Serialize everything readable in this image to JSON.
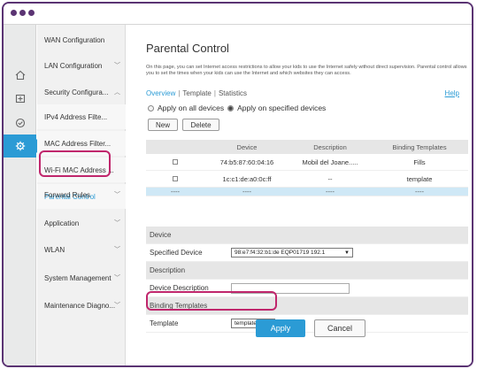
{
  "window": {
    "colors": {
      "frame": "#5b3473",
      "accent": "#2b9bd5",
      "highlight": "#c0266c"
    }
  },
  "sidebar": {
    "items": [
      {
        "label": "WAN Configuration",
        "has_chevron": false
      },
      {
        "label": "LAN Configuration",
        "has_chevron": true
      },
      {
        "label": "Security Configura...",
        "has_chevron": true
      },
      {
        "label": "IPv4 Address Filte..."
      },
      {
        "label": "MAC Address Filter..."
      },
      {
        "label": "Wi-Fi MAC Address ..."
      },
      {
        "label": "Parental Control"
      },
      {
        "label": "Forward Rules",
        "has_chevron": true
      },
      {
        "label": "Application",
        "has_chevron": true
      },
      {
        "label": "WLAN",
        "has_chevron": true
      },
      {
        "label": "System Management",
        "has_chevron": true
      },
      {
        "label": "Maintenance Diagno...",
        "has_chevron": true
      }
    ],
    "chevron_down": "﹀",
    "chevron_up": "︿"
  },
  "icons": [
    "home-icon",
    "plus-box-icon",
    "shield-check-icon",
    "gear-icon"
  ],
  "main": {
    "title": "Parental Control",
    "description": "On this page, you can set Internet access restrictions to allow your kids to use the Internet safely without direct supervision. Parental control allows you to set the times when your kids can use the Internet and which websites they can access.",
    "tabs": {
      "overview": "Overview",
      "template": "Template",
      "statistics": "Statistics"
    },
    "help": "Help",
    "radio_all": "Apply on all devices",
    "radio_specified": "Apply on specified devices",
    "new_label": "New",
    "delete_label": "Delete",
    "table": {
      "headers": [
        "",
        "Device",
        "Description",
        "Binding Templates"
      ],
      "rows": [
        [
          "",
          "74:b5:87:60:04:16",
          "Mobil del Joane.....",
          "Fills"
        ],
        [
          "",
          "1c:c1:de:a0:0c:ff",
          "--",
          "template"
        ],
        [
          "----",
          "----",
          "----",
          "----"
        ]
      ]
    },
    "form": {
      "device_section": "Device",
      "specified_device_label": "Specified Device",
      "specified_device_value": "98:e7:f4:32:b1:de  EQP01719  192.1",
      "description_section": "Description",
      "device_description_label": "Device Description",
      "device_description_value": "",
      "binding_section": "Binding Templates",
      "template_label": "Template",
      "template_value": "template"
    },
    "apply_label": "Apply",
    "cancel_label": "Cancel"
  }
}
